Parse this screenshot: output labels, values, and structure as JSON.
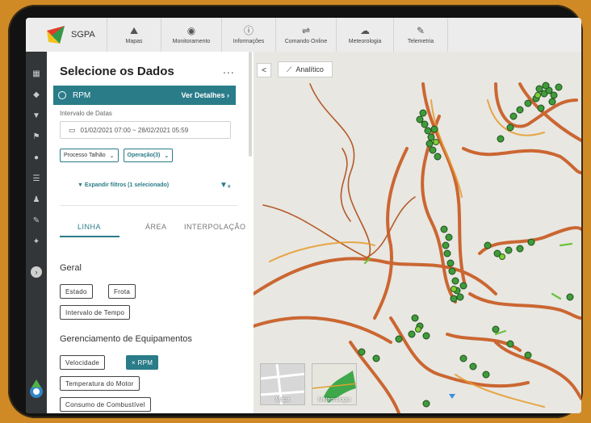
{
  "app": {
    "name": "SGPA"
  },
  "nav": {
    "tabs": [
      {
        "label": "Mapas",
        "icon": "map-pin-icon"
      },
      {
        "label": "Monitoramento",
        "icon": "eye-icon"
      },
      {
        "label": "Informações",
        "icon": "info-icon"
      },
      {
        "label": "Comando Online",
        "icon": "command-icon"
      },
      {
        "label": "Meteorologia",
        "icon": "weather-icon"
      },
      {
        "label": "Telemetria",
        "icon": "wrench-icon"
      }
    ]
  },
  "rail": {
    "icons": [
      "grid-icon",
      "tag-icon",
      "filter-icon",
      "flag-icon",
      "location-icon",
      "chat-icon",
      "user-icon",
      "edit-icon",
      "wrench-icon",
      "arrow-right-circle-icon"
    ]
  },
  "panel": {
    "title": "Selecione os Dados",
    "more": "...",
    "selected": {
      "label": "RPM",
      "details": "Ver Detalhes ›"
    },
    "date_label": "Intervalo de Datas",
    "date_value": "01/02/2021 07:00  ~  28/02/2021 05:59",
    "selects": [
      {
        "label": "Processo Talhão"
      },
      {
        "label": "Operação(3)"
      }
    ],
    "expand_filters": "Expandir filtros (1 selecionado)",
    "tabs": [
      "LINHA",
      "ÁREA",
      "INTERPOLAÇÃO"
    ],
    "sections": {
      "geral": {
        "title": "Geral",
        "chips": [
          "Estado",
          "Frota",
          "Intervalo de Tempo"
        ]
      },
      "equip": {
        "title": "Gerenciamento de Equipamentos",
        "chips": [
          "Velocidade",
          "× RPM",
          "Temperatura do Motor",
          "Consumo de Combustível"
        ]
      }
    }
  },
  "map": {
    "analytics_label": "Analítico",
    "collapse": "<",
    "thumbs": [
      "Mapa",
      "Meteorologia"
    ]
  },
  "colors": {
    "accent": "#2a7c89",
    "track": "#c8591f",
    "marker": "#3f9b3a"
  }
}
